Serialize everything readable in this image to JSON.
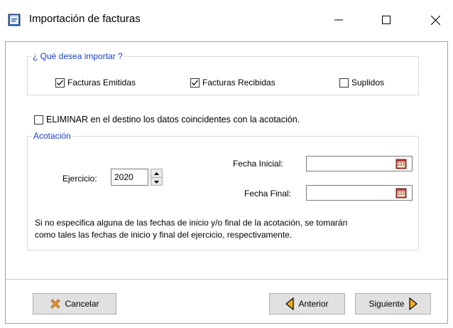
{
  "window": {
    "title": "Importación de facturas",
    "minimize_glyph": "—",
    "maximize_glyph": "☐",
    "close_glyph": "✕"
  },
  "import_group": {
    "legend": "¿ Qué desea importar ?",
    "options": [
      {
        "label": "Facturas Emitidas",
        "checked": true
      },
      {
        "label": "Facturas Recibidas",
        "checked": true
      },
      {
        "label": "Suplidos",
        "checked": false
      }
    ]
  },
  "delete_option": {
    "label": "ELIMINAR en el destino los datos coincidentes con la acotación.",
    "checked": false
  },
  "acotacion": {
    "legend": "Acotación",
    "ejercicio_label": "Ejercicio:",
    "ejercicio_value": "2020",
    "fecha_inicial_label": "Fecha Inicial:",
    "fecha_inicial_value": "",
    "fecha_final_label": "Fecha Final:",
    "fecha_final_value": "",
    "note_line1": "Si no especifica alguna de las fechas de inicio y/o final de la acotación, se tomarán",
    "note_line2": "como tales las fechas de inicio y final del ejercicio, respectivamente."
  },
  "buttons": {
    "cancel": "Cancelar",
    "previous": "Anterior",
    "next": "Siguiente"
  },
  "icons": {
    "app": "app-window-icon",
    "calendar": "calendar-icon",
    "cancel": "cancel-x-icon",
    "previous": "arrow-left-icon",
    "next": "arrow-right-icon"
  },
  "colors": {
    "legend_text": "#1a3fc7",
    "button_face": "#e1e1e1",
    "cancel_icon": "#e89a2c",
    "arrow_icon": "#f2b01e"
  }
}
